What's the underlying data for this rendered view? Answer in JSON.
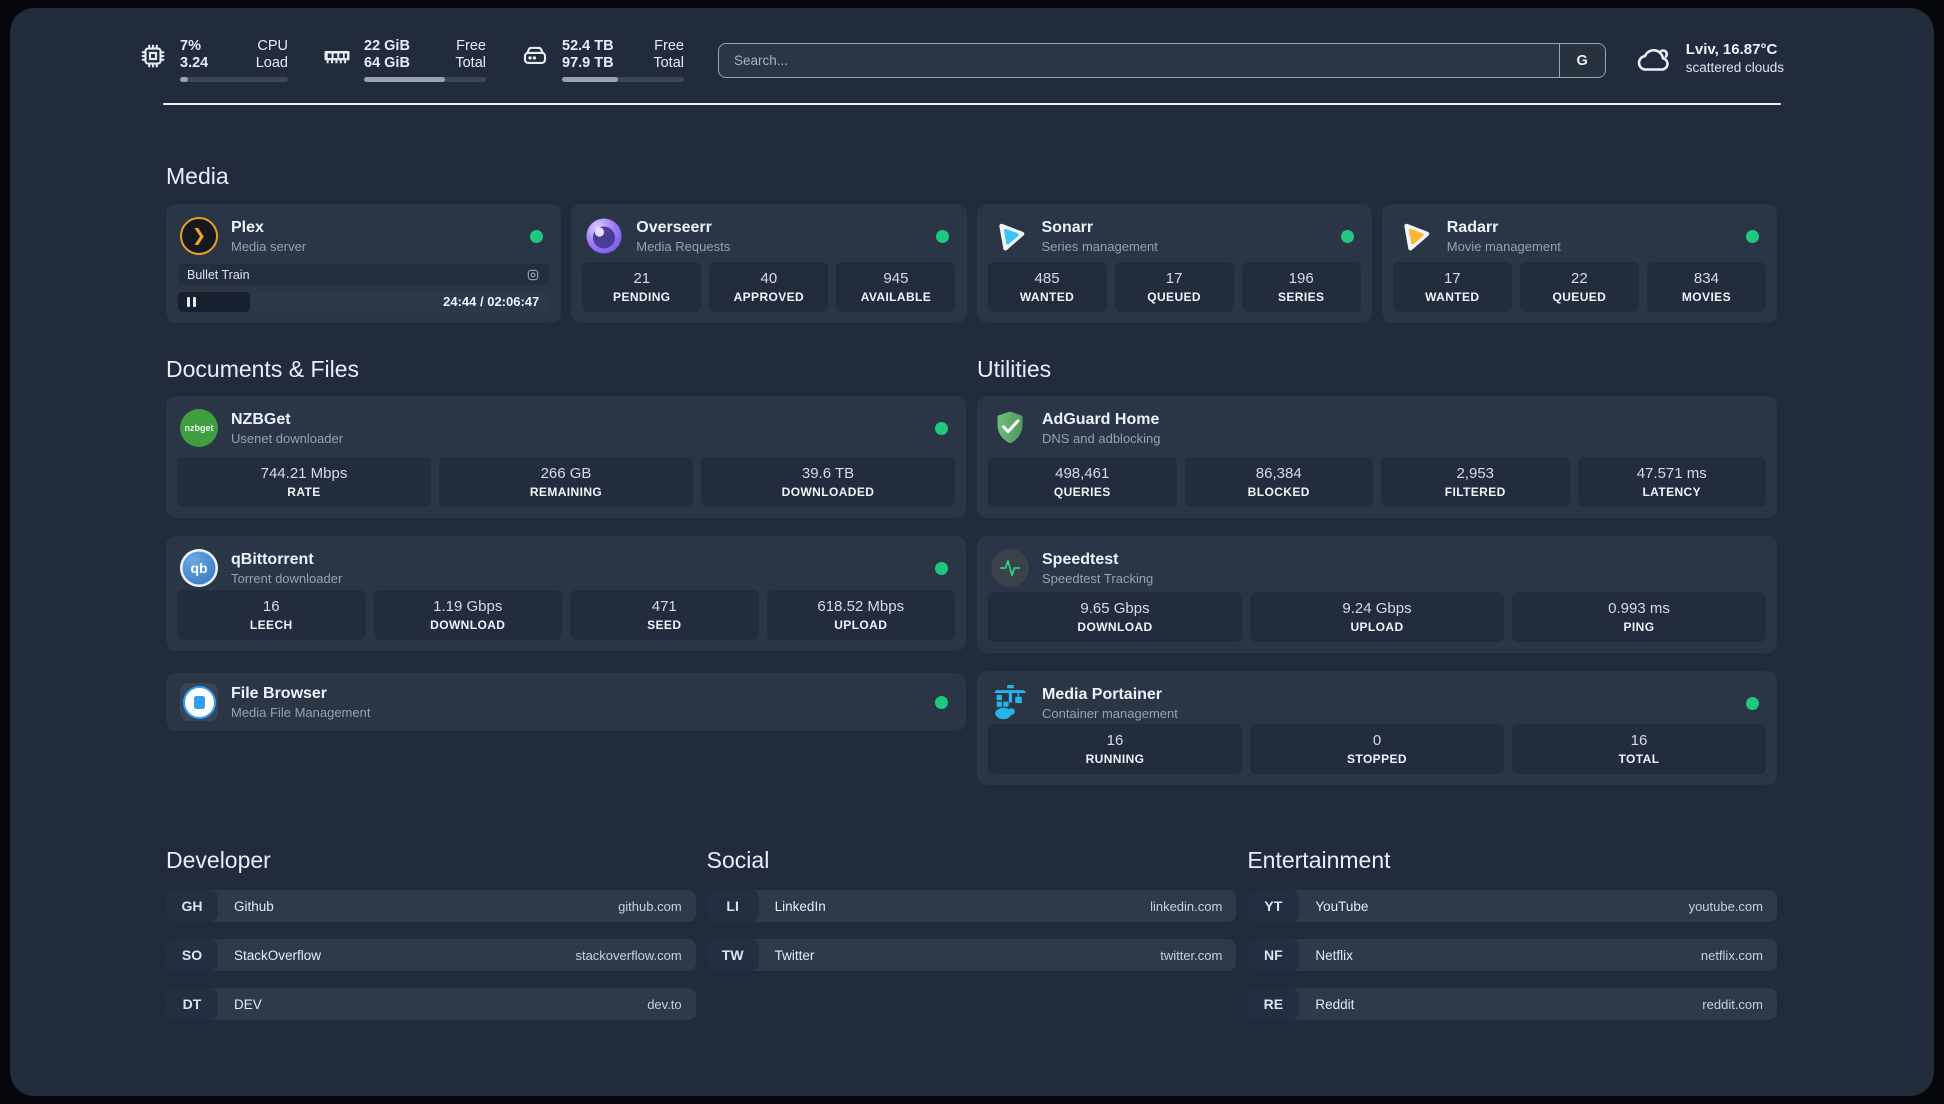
{
  "header": {
    "stats": [
      {
        "icon": "cpu-icon",
        "value_top": "7%",
        "value_bottom": "3.24",
        "label_top": "CPU",
        "label_bottom": "Load",
        "progress_pct": 7
      },
      {
        "icon": "ram-icon",
        "value_top": "22 GiB",
        "value_bottom": "64 GiB",
        "label_top": "Free",
        "label_bottom": "Total",
        "progress_pct": 66
      },
      {
        "icon": "disk-icon",
        "value_top": "52.4 TB",
        "value_bottom": "97.9 TB",
        "label_top": "Free",
        "label_bottom": "Total",
        "progress_pct": 46
      }
    ],
    "search": {
      "placeholder": "Search...",
      "engine_button": "G"
    },
    "weather": {
      "location": "Lviv, 16.87°C",
      "condition": "scattered clouds"
    }
  },
  "icons": {
    "plex_glyph": "❯",
    "qbittorrent_glyph": "qb",
    "nzbget_glyph": "nzbget"
  },
  "sections": {
    "media": {
      "title": "Media",
      "cards": [
        {
          "name": "Plex",
          "subtitle": "Media server",
          "online": true,
          "now_playing": {
            "title": "Bullet Train",
            "time": "24:44 / 02:06:47",
            "progress_pct": 19.5,
            "state": "paused"
          }
        },
        {
          "name": "Overseerr",
          "subtitle": "Media Requests",
          "online": true,
          "stats": [
            {
              "value": "21",
              "label": "PENDING"
            },
            {
              "value": "40",
              "label": "APPROVED"
            },
            {
              "value": "945",
              "label": "AVAILABLE"
            }
          ]
        },
        {
          "name": "Sonarr",
          "subtitle": "Series management",
          "online": true,
          "stats": [
            {
              "value": "485",
              "label": "WANTED"
            },
            {
              "value": "17",
              "label": "QUEUED"
            },
            {
              "value": "196",
              "label": "SERIES"
            }
          ]
        },
        {
          "name": "Radarr",
          "subtitle": "Movie management",
          "online": true,
          "stats": [
            {
              "value": "17",
              "label": "WANTED"
            },
            {
              "value": "22",
              "label": "QUEUED"
            },
            {
              "value": "834",
              "label": "MOVIES"
            }
          ]
        }
      ]
    },
    "documents": {
      "title": "Documents & Files",
      "cards": [
        {
          "name": "NZBGet",
          "subtitle": "Usenet downloader",
          "online": true,
          "stats": [
            {
              "value": "744.21 Mbps",
              "label": "RATE"
            },
            {
              "value": "266 GB",
              "label": "REMAINING"
            },
            {
              "value": "39.6 TB",
              "label": "DOWNLOADED"
            }
          ]
        },
        {
          "name": "qBittorrent",
          "subtitle": "Torrent downloader",
          "online": true,
          "stats": [
            {
              "value": "16",
              "label": "LEECH"
            },
            {
              "value": "1.19 Gbps",
              "label": "DOWNLOAD"
            },
            {
              "value": "471",
              "label": "SEED"
            },
            {
              "value": "618.52 Mbps",
              "label": "UPLOAD"
            }
          ]
        },
        {
          "name": "File Browser",
          "subtitle": "Media File Management",
          "online": true
        }
      ]
    },
    "utilities": {
      "title": "Utilities",
      "cards": [
        {
          "name": "AdGuard Home",
          "subtitle": "DNS and adblocking",
          "stats": [
            {
              "value": "498,461",
              "label": "QUERIES"
            },
            {
              "value": "86,384",
              "label": "BLOCKED"
            },
            {
              "value": "2,953",
              "label": "FILTERED"
            },
            {
              "value": "47.571 ms",
              "label": "LATENCY"
            }
          ]
        },
        {
          "name": "Speedtest",
          "subtitle": "Speedtest Tracking",
          "stats": [
            {
              "value": "9.65 Gbps",
              "label": "DOWNLOAD"
            },
            {
              "value": "9.24 Gbps",
              "label": "UPLOAD"
            },
            {
              "value": "0.993 ms",
              "label": "PING"
            }
          ]
        },
        {
          "name": "Media Portainer",
          "subtitle": "Container management",
          "online": true,
          "stats": [
            {
              "value": "16",
              "label": "RUNNING"
            },
            {
              "value": "0",
              "label": "STOPPED"
            },
            {
              "value": "16",
              "label": "TOTAL"
            }
          ]
        }
      ]
    },
    "developer": {
      "title": "Developer",
      "links": [
        {
          "prefix": "GH",
          "name": "Github",
          "url": "github.com"
        },
        {
          "prefix": "SO",
          "name": "StackOverflow",
          "url": "stackoverflow.com"
        },
        {
          "prefix": "DT",
          "name": "DEV",
          "url": "dev.to"
        }
      ]
    },
    "social": {
      "title": "Social",
      "links": [
        {
          "prefix": "LI",
          "name": "LinkedIn",
          "url": "linkedin.com"
        },
        {
          "prefix": "TW",
          "name": "Twitter",
          "url": "twitter.com"
        }
      ]
    },
    "entertainment": {
      "title": "Entertainment",
      "links": [
        {
          "prefix": "YT",
          "name": "YouTube",
          "url": "youtube.com"
        },
        {
          "prefix": "NF",
          "name": "Netflix",
          "url": "netflix.com"
        },
        {
          "prefix": "RE",
          "name": "Reddit",
          "url": "reddit.com"
        }
      ]
    }
  },
  "colors": {
    "status_online": "#1fc77f",
    "panel": "#212b3c",
    "card": "#2a3546",
    "stat_box": "#222c3c"
  }
}
